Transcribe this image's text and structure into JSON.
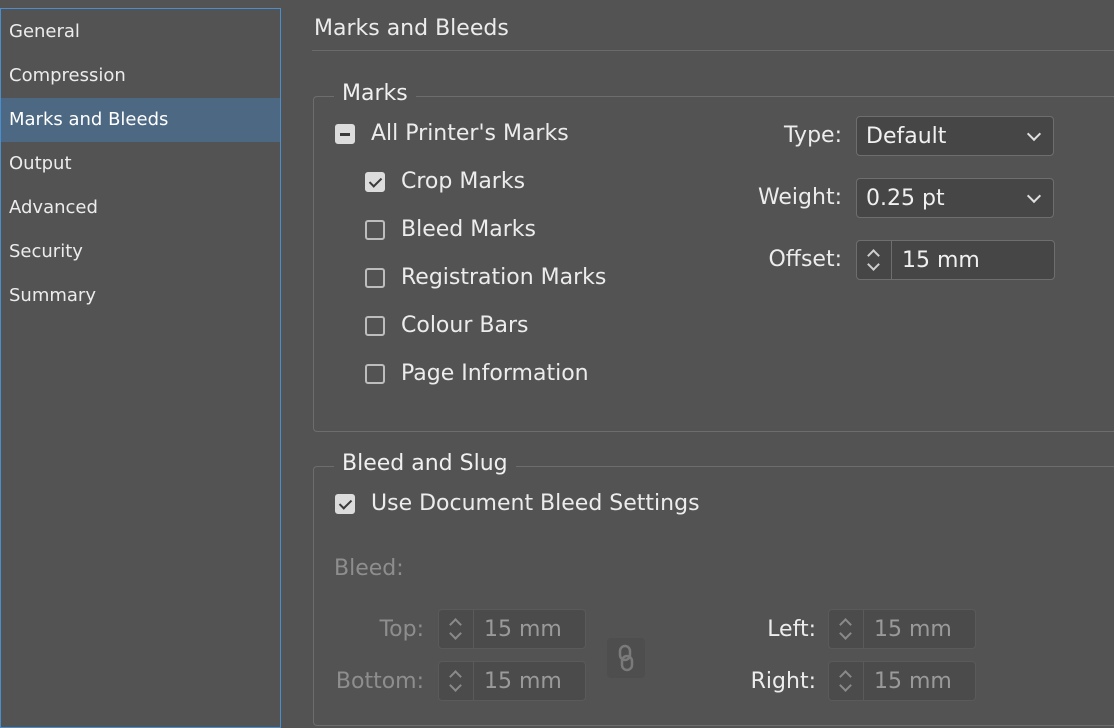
{
  "sidebar": {
    "items": [
      {
        "label": "General"
      },
      {
        "label": "Compression"
      },
      {
        "label": "Marks and Bleeds",
        "selected": true
      },
      {
        "label": "Output"
      },
      {
        "label": "Advanced"
      },
      {
        "label": "Security"
      },
      {
        "label": "Summary"
      }
    ]
  },
  "page_title": "Marks and Bleeds",
  "marks": {
    "legend": "Marks",
    "all_printers_marks": {
      "label": "All Printer's Marks",
      "state": "mixed"
    },
    "options": [
      {
        "label": "Crop Marks",
        "checked": true
      },
      {
        "label": "Bleed Marks",
        "checked": false
      },
      {
        "label": "Registration Marks",
        "checked": false
      },
      {
        "label": "Colour Bars",
        "checked": false
      },
      {
        "label": "Page Information",
        "checked": false
      }
    ],
    "type": {
      "label": "Type:",
      "value": "Default"
    },
    "weight": {
      "label": "Weight:",
      "value": "0.25 pt"
    },
    "offset": {
      "label": "Offset:",
      "value": "15 mm"
    }
  },
  "bleed_slug": {
    "legend": "Bleed and Slug",
    "use_document_bleed": {
      "label": "Use Document Bleed Settings",
      "checked": true
    },
    "bleed_label": "Bleed:",
    "top": {
      "label": "Top:",
      "value": "15 mm"
    },
    "bottom": {
      "label": "Bottom:",
      "value": "15 mm"
    },
    "left": {
      "label": "Left:",
      "value": "15 mm"
    },
    "right": {
      "label": "Right:",
      "value": "15 mm"
    }
  },
  "colors": {
    "background": "#535353",
    "sidebar_selected": "#4c6883",
    "focus_border": "#4a8ed0"
  }
}
